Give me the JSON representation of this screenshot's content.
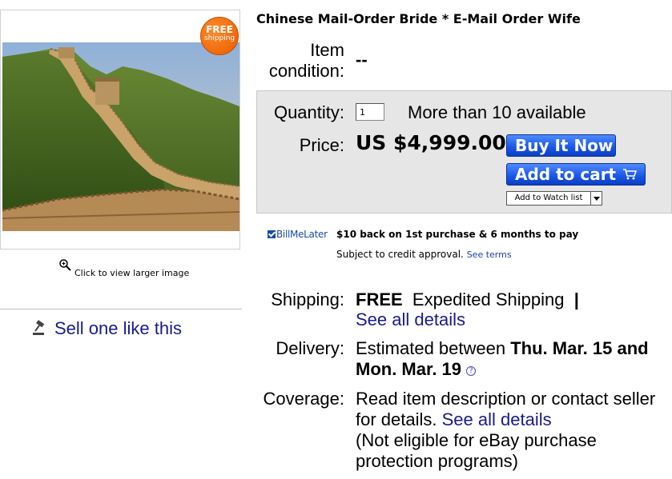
{
  "listing": {
    "title": "Chinese Mail-Order Bride * E-Mail Order Wife",
    "free_badge_top": "FREE",
    "free_badge_bottom": "shipping",
    "zoom_text": "Click to view larger image",
    "sell_text": "Sell one like this"
  },
  "details": {
    "condition_label": "Item condition:",
    "condition_value": "--",
    "quantity_label": "Quantity:",
    "quantity_value": "1",
    "quantity_available": "More than 10 available",
    "price_label": "Price:",
    "price_value": "US $4,999.00",
    "buy_now_label": "Buy It Now",
    "add_to_cart_label": "Add to cart",
    "watch_label": "Add to Watch list"
  },
  "billmelater": {
    "logo": "BillMeLater",
    "offer": "$10 back on 1st purchase & 6 months to pay",
    "subject": "Subject to credit approval.",
    "terms": "See terms"
  },
  "shipping": {
    "label": "Shipping:",
    "free": "FREE",
    "method": "Expedited Shipping",
    "separator": "|",
    "details_link": "See all details"
  },
  "delivery": {
    "label": "Delivery:",
    "text": "Estimated between",
    "dates": "Thu. Mar. 15 and Mon. Mar. 19",
    "help": "?"
  },
  "coverage": {
    "label": "Coverage:",
    "text": "Read item description or contact seller for details.",
    "details_link": "See all details",
    "note": "(Not eligible for eBay purchase protection programs)"
  },
  "colors": {
    "link": "#1a1a8c",
    "button_blue": "#1a55e6",
    "badge_orange": "#e85b00",
    "panel_gray": "#e6e6e6"
  }
}
